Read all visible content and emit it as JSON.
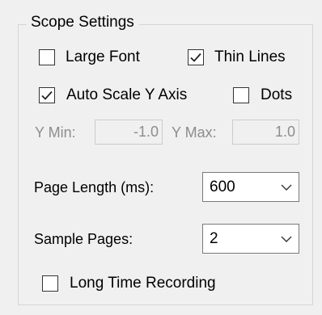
{
  "group": {
    "title": "Scope Settings"
  },
  "checkboxes": {
    "large_font": {
      "label": "Large Font",
      "checked": false
    },
    "thin_lines": {
      "label": "Thin Lines",
      "checked": true
    },
    "auto_scale": {
      "label": "Auto Scale Y Axis",
      "checked": true
    },
    "dots": {
      "label": "Dots",
      "checked": false
    },
    "long_time": {
      "label": "Long Time Recording",
      "checked": false
    }
  },
  "y_range": {
    "min_label": "Y Min:",
    "min_value": "-1.0",
    "max_label": "Y Max:",
    "max_value": "1.0",
    "disabled": true
  },
  "page_length": {
    "label": "Page Length (ms):",
    "value": "600"
  },
  "sample_pages": {
    "label": "Sample Pages:",
    "value": "2"
  },
  "icons": {
    "check": "checkmark-icon",
    "dropdown": "chevron-down-icon"
  },
  "colors": {
    "background": "#f0f0f0",
    "group_border": "#d5d5d5",
    "disabled_text": "#8d8d8d",
    "combo_border": "#7a7a7a"
  }
}
